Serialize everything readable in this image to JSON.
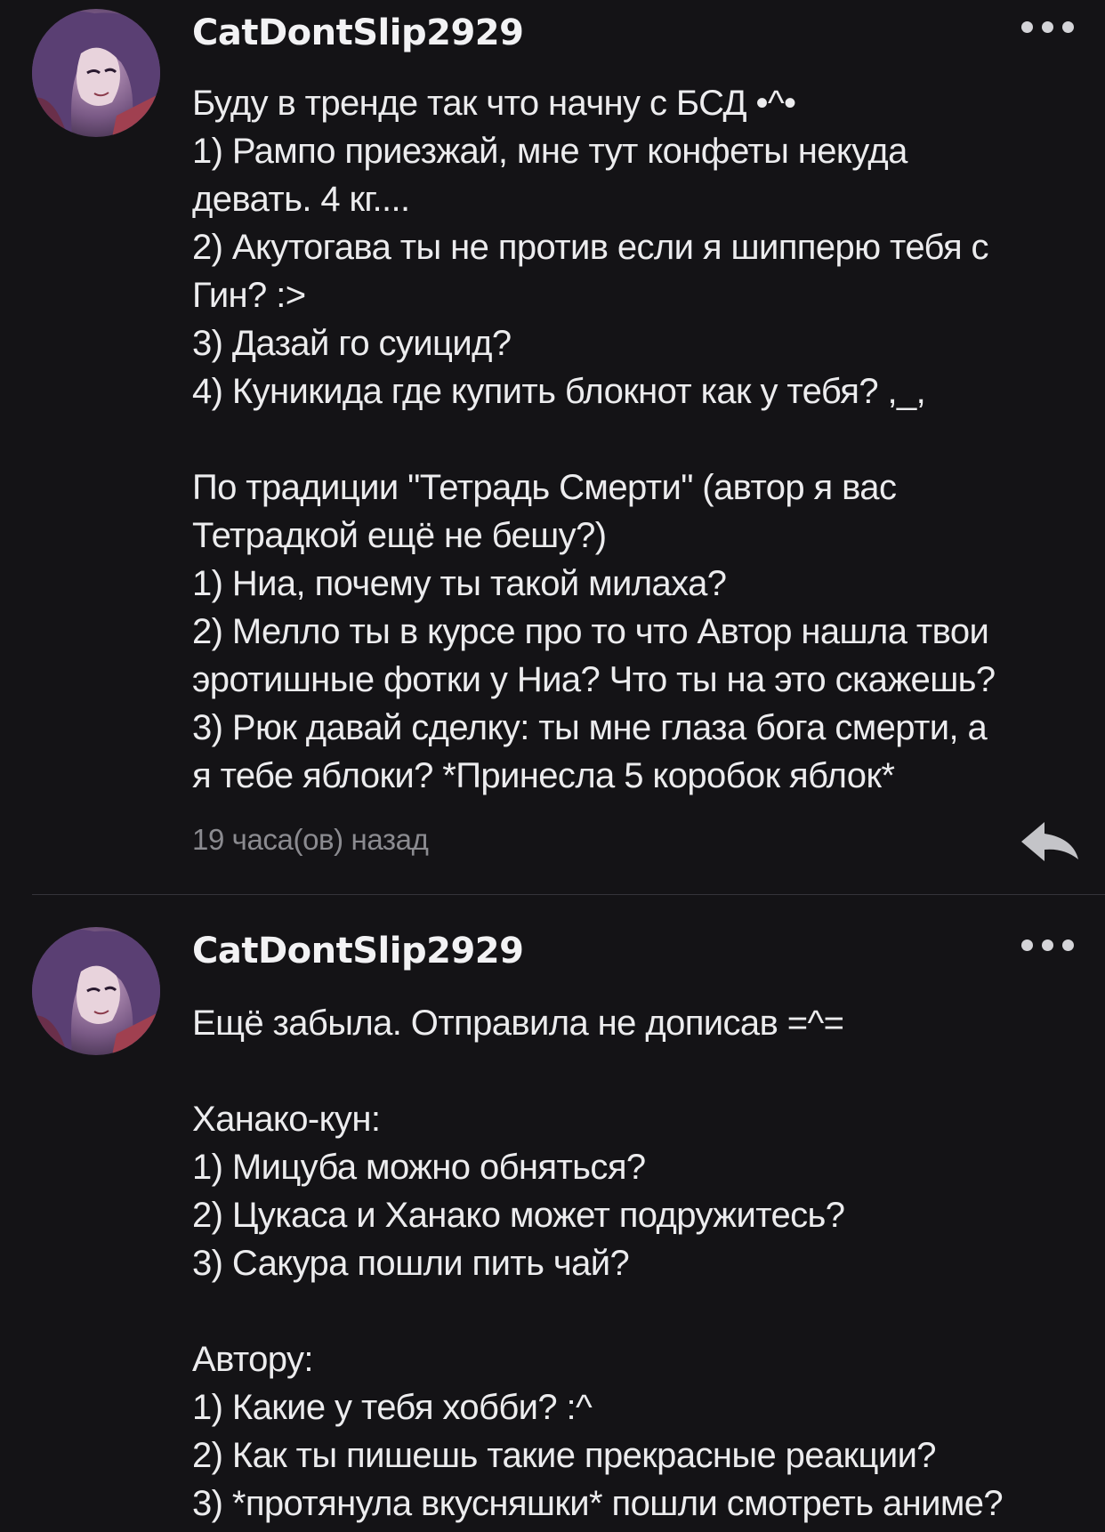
{
  "comments": [
    {
      "username": "CatDontSlip2929",
      "lines": [
        "Буду в тренде так что начну с БСД •^•",
        "1) Рампо приезжай, мне тут конфеты некуда",
        "девать. 4 кг....",
        "2) Акутогава ты не против если я шипперю тебя с",
        "Гин? :>",
        "3) Дазай го суицид?",
        "4) Куникида где купить блокнот как у тебя? ,_,",
        "",
        "По традиции \"Тетрадь Смерти\" (автор я вас",
        "Тетрадкой ещё не бешу?)",
        "1) Ниа, почему ты такой милаха?",
        "2) Мелло ты в курсе про то что Автор нашла твои",
        "эротишные фотки у Ниа? Что ты на это скажешь?",
        "3) Рюк давай сделку: ты мне глаза бога смерти, а",
        "я тебе яблоки? *Принесла 5 коробок яблок*"
      ],
      "timestamp": "19 часа(ов) назад",
      "menu_icon": "more-dots-icon",
      "reply_icon": "reply-arrow-icon"
    },
    {
      "username": "CatDontSlip2929",
      "lines": [
        "Ещё забыла. Отправила не дописав =^=",
        "",
        "Ханако-кун:",
        "1) Мицуба можно обняться?",
        "2) Цукаса и Ханако может подружитесь?",
        "3) Сакура пошли пить чай?",
        "",
        "Автору:",
        "1) Какие у тебя хобби? :^",
        "2) Как ты пишешь такие прекрасные реакции?",
        "3) *протянула вкусняшки* пошли смотреть аниме?"
      ],
      "menu_icon": "more-dots-icon"
    }
  ],
  "colors": {
    "background": "#141316",
    "text": "#ececee",
    "muted": "#8b8b90",
    "divider": "#35343a"
  }
}
